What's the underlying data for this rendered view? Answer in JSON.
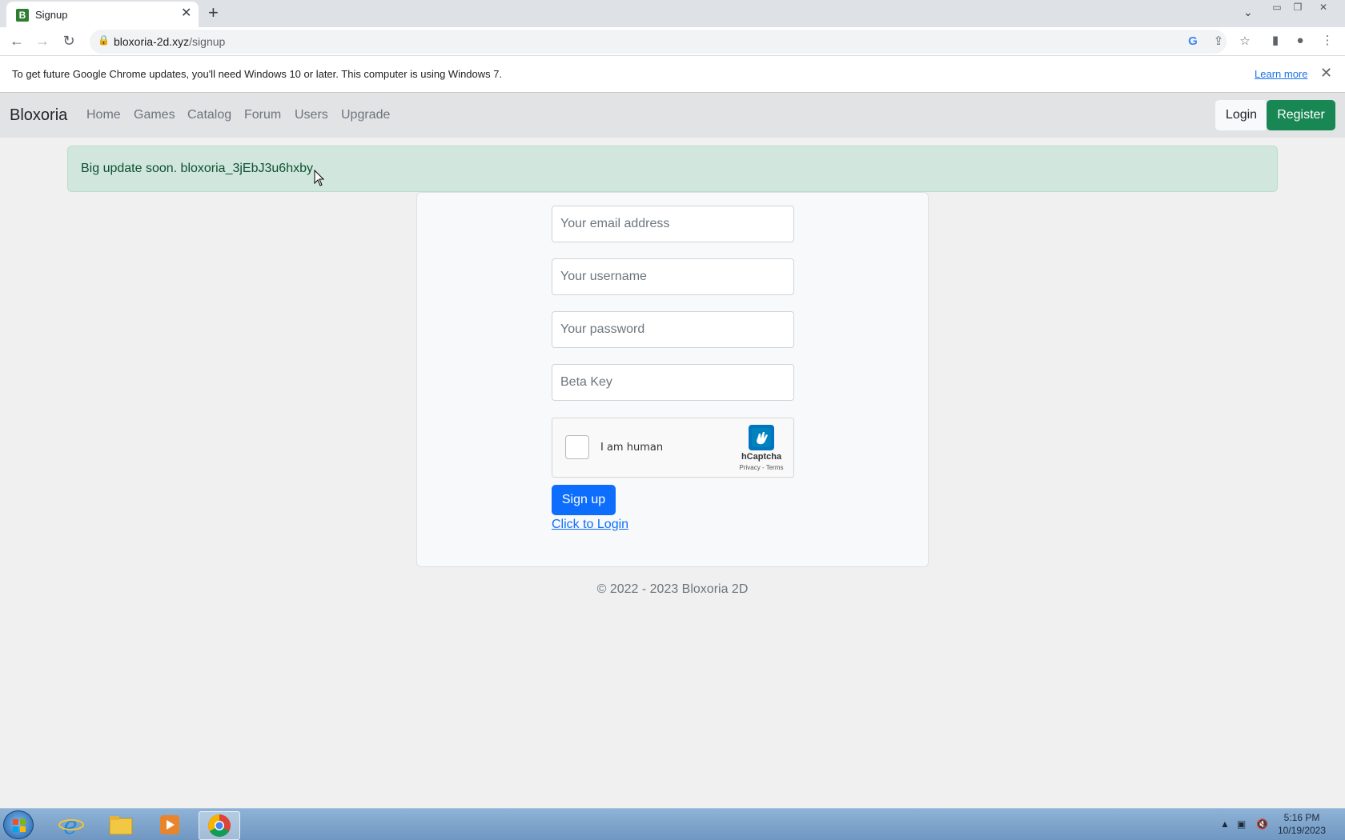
{
  "browser": {
    "tab_title": "Signup",
    "tab_favicon": "B",
    "url_domain": "bloxoria-2d.xyz",
    "url_path": "/signup"
  },
  "infobar": {
    "message": "To get future Google Chrome updates, you'll need Windows 10 or later. This computer is using Windows 7.",
    "learn_more": "Learn more"
  },
  "navbar": {
    "brand": "Bloxoria",
    "links": [
      "Home",
      "Games",
      "Catalog",
      "Forum",
      "Users",
      "Upgrade"
    ],
    "login": "Login",
    "register": "Register"
  },
  "alert": {
    "text": "Big update soon. bloxoria_3jEbJ3u6hxby"
  },
  "form": {
    "email_placeholder": "Your email address",
    "username_placeholder": "Your username",
    "password_placeholder": "Your password",
    "betakey_placeholder": "Beta Key",
    "captcha_label": "I am human",
    "captcha_brand": "hCaptcha",
    "captcha_terms": "Privacy - Terms",
    "signup_button": "Sign up",
    "login_link": "Click to Login"
  },
  "footer": {
    "text": "© 2022 - 2023 Bloxoria 2D"
  },
  "taskbar": {
    "time": "5:16 PM",
    "date": "10/19/2023"
  },
  "colors": {
    "register_green": "#198754",
    "signup_blue": "#0d6efd",
    "alert_bg": "#d1e7dd",
    "navbar_bg": "#e2e3e5"
  }
}
